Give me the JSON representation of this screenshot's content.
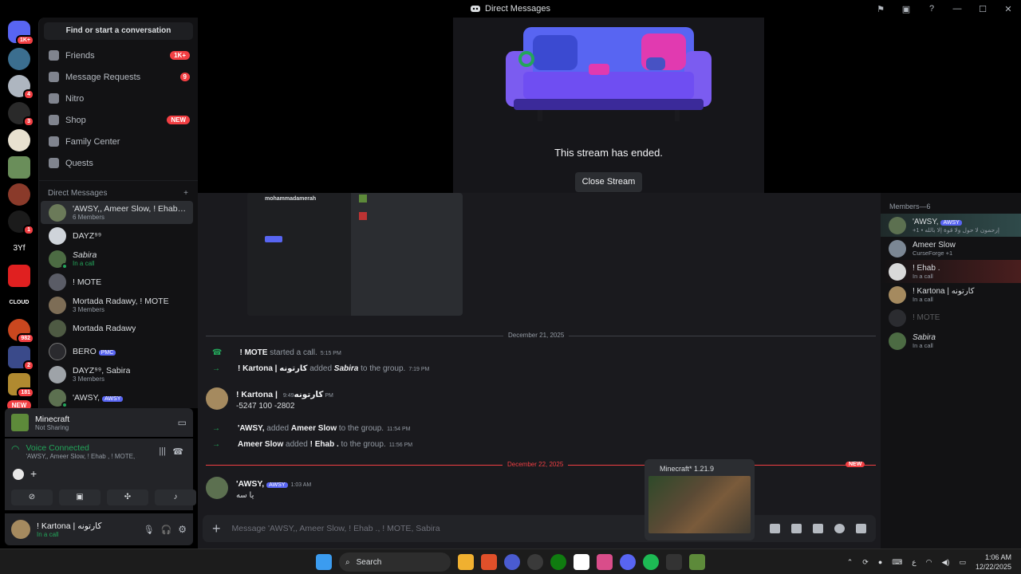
{
  "window": {
    "title": "Direct Messages"
  },
  "rail": {
    "badges": [
      "1K+",
      "4",
      "3",
      "1",
      "982",
      "2",
      "181"
    ],
    "labels": [
      "3Yf",
      "CLOUD"
    ],
    "new_pill": "NEW"
  },
  "sidebar": {
    "find_placeholder": "Find or start a conversation",
    "nav": [
      {
        "label": "Friends",
        "badge": "1K+"
      },
      {
        "label": "Message Requests",
        "badge": "9"
      },
      {
        "label": "Nitro",
        "badge": ""
      },
      {
        "label": "Shop",
        "badge": "NEW"
      },
      {
        "label": "Family Center",
        "badge": ""
      },
      {
        "label": "Quests",
        "badge": ""
      }
    ],
    "dm_header": "Direct Messages",
    "dm_add": "+",
    "dms": [
      {
        "name": "'AWSY,, Ameer Slow, ! Ehab , ...",
        "sub": "6 Members",
        "color": "#6b7a59"
      },
      {
        "name": "DAYZ⁹⁹",
        "sub": "",
        "color": "#cfd4da"
      },
      {
        "name": "Sabira",
        "sub": "In a call",
        "color": "#4c6b43"
      },
      {
        "name": "! MOTE",
        "sub": "",
        "color": "#5a5c66"
      },
      {
        "name": "Mortada Radawy, ! MOTE",
        "sub": "3 Members",
        "color": "#7d6d56"
      },
      {
        "name": "Mortada Radawy",
        "sub": "",
        "color": "#4e5a43"
      },
      {
        "name": "BERO",
        "sub": "",
        "color": "#2a2a2e",
        "tag": "PMC"
      },
      {
        "name": "DAYZ⁹⁹, Sabira",
        "sub": "3 Members",
        "color": "#9ea3a8"
      },
      {
        "name": "'AWSY,",
        "sub": "",
        "color": "#5c7050",
        "tag": "AWSY"
      }
    ]
  },
  "activity": {
    "game": "Minecraft",
    "status": "Not Sharing"
  },
  "voice": {
    "title": "Voice Connected",
    "channel": "'AWSY,, Ameer Slow, ! Ehab , ! MOTE, S..."
  },
  "user": {
    "name": "! Kartona | كارتونه",
    "status": "In a call"
  },
  "stream": {
    "ended_text": "This stream has ended.",
    "close_label": "Close Stream"
  },
  "chat": {
    "embed_name": "mohammadamerah",
    "date1": "December 21, 2025",
    "sys1": {
      "author": "! MOTE",
      "text": "started a call.",
      "time": "5:15 PM"
    },
    "sys2": {
      "author": "! Kartona | كارتونه",
      "text": "added",
      "target": "Sabira",
      "suffix": "to the group.",
      "time": "7:19 PM"
    },
    "msg1": {
      "author": "! Kartona | كارتونه",
      "time": "9:49 PM",
      "body": "-5247 100 -2802"
    },
    "sys3": {
      "author": "'AWSY,",
      "text": "added",
      "target": "Ameer Slow",
      "suffix": "to the group.",
      "time": "11:54 PM"
    },
    "sys4": {
      "author": "Ameer Slow",
      "text": "added",
      "target": "! Ehab .",
      "suffix": "to the group.",
      "time": "11:56 PM"
    },
    "date2": "December 22, 2025",
    "new_label": "NEW",
    "msg2": {
      "author": "'AWSY,",
      "tag": "AWSY",
      "time": "1:03 AM",
      "body": "يا سه"
    },
    "composer_placeholder": "Message 'AWSY,, Ameer Slow, ! Ehab ., ! MOTE, Sabira"
  },
  "members": {
    "title": "Members—6",
    "list": [
      {
        "name": "'AWSY,",
        "sub": "+1 • إرحمون لا حول ولا قوة إلا بالله",
        "tag": "AWSY",
        "color": "#5c7050"
      },
      {
        "name": "Ameer Slow",
        "sub": "CurseForge +1",
        "color": "#7b8794"
      },
      {
        "name": "! Ehab .",
        "sub": "In a call",
        "color": "#d9d9d9"
      },
      {
        "name": "! Kartona | كارتونه",
        "sub": "In a call",
        "color": "#a58a5f"
      },
      {
        "name": "! MOTE",
        "sub": "",
        "color": "#5a5c66"
      },
      {
        "name": "Sabira",
        "sub": "In a call",
        "color": "#4c6b43"
      }
    ]
  },
  "preview": {
    "title": "Minecraft* 1.21.9"
  },
  "taskbar": {
    "search": "Search",
    "lang": "ع",
    "time": "1:06 AM",
    "date": "12/22/2025"
  }
}
